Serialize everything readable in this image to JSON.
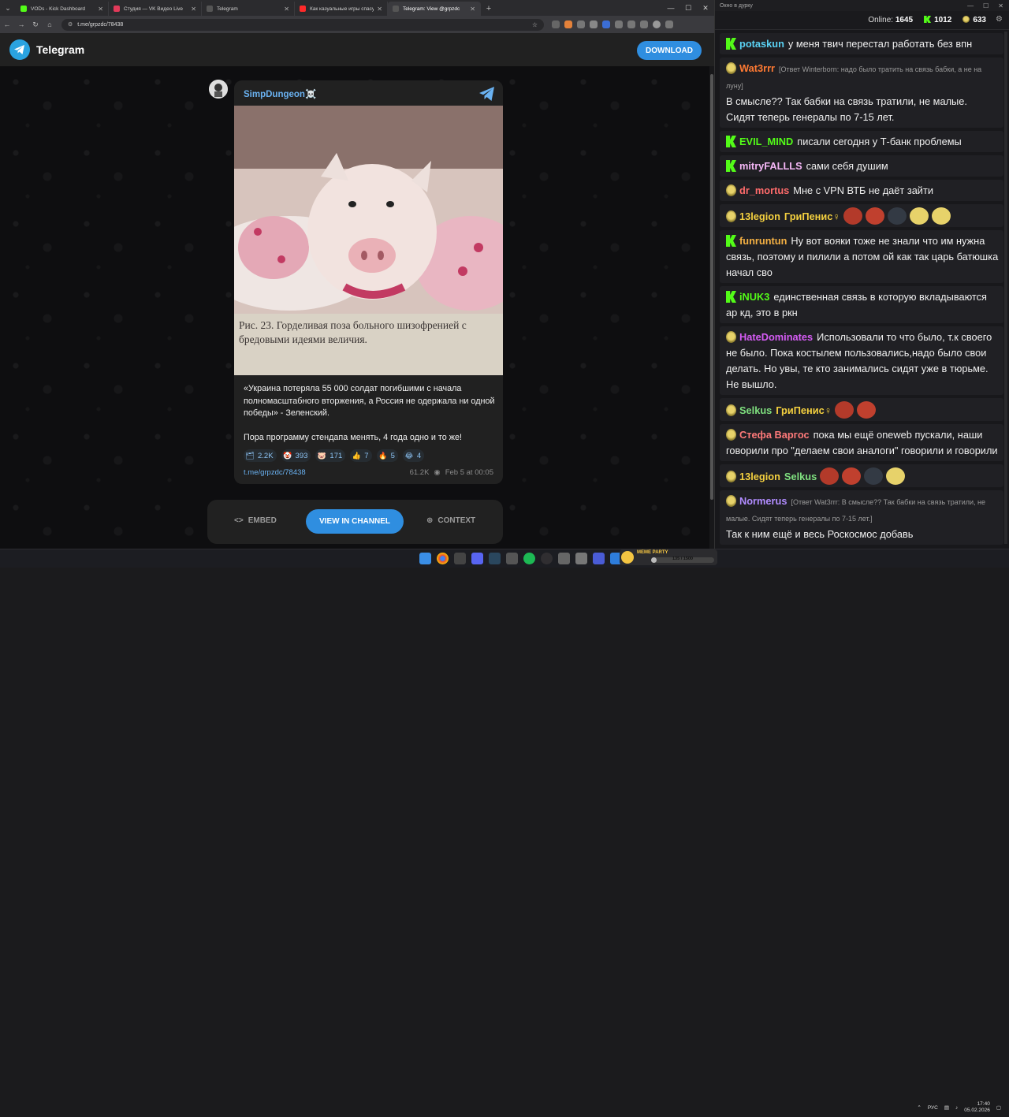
{
  "browser": {
    "tabs": [
      {
        "title": "VODs - Kick Dashboard",
        "favicon_color": "#53fc18"
      },
      {
        "title": "Студия — VK Видео Live",
        "favicon_color": "#e23a5a"
      },
      {
        "title": "Telegram",
        "favicon_color": "#555555"
      },
      {
        "title": "Как казуальные игры спасут ...",
        "favicon_color": "#ff2a2a"
      },
      {
        "title": "Telegram: View @grpzdc",
        "favicon_color": "#555555"
      }
    ],
    "url": "t.me/grpzdc/78438"
  },
  "telegram": {
    "brand": "Telegram",
    "download_label": "DOWNLOAD",
    "channel_name": "SimpDungeon☠️",
    "image_caption": "Рис. 23. Горделивая поза больного шизофренией с бредовыми идеями величия.",
    "post_text_1": "«Украина потеряла 55 000 солдат погибшими с начала полномасштабного вторжения, а Россия не одержала ни одной победы» - Зеленский.",
    "post_text_2": "Пора программу стендапа менять, 4 года одно и то же!",
    "reactions": [
      {
        "emoji": "🗂",
        "count": "2.2K"
      },
      {
        "emoji": "🤡",
        "count": "393"
      },
      {
        "emoji": "🐷",
        "count": "171"
      },
      {
        "emoji": "👍",
        "count": "7"
      },
      {
        "emoji": "🔥",
        "count": "5"
      },
      {
        "emoji": "😂",
        "count": "4"
      }
    ],
    "post_link": "t.me/grpzdc/78438",
    "views": "61.2K",
    "date": "Feb 5 at 00:05",
    "embed_label": "EMBED",
    "view_channel_label": "VIEW IN CHANNEL",
    "context_label": "CONTEXT"
  },
  "chat": {
    "window_title": "Окно в дурку",
    "online_label": "Online:",
    "online_count": "1645",
    "kick_count": "1012",
    "vk_count": "633",
    "messages": [
      {
        "badge": "k",
        "user": "potaskun",
        "color": "#5ad2f4",
        "reply": "",
        "text": "у меня твич перестал работать без впн"
      },
      {
        "badge": "peepo",
        "user": "Wat3rrr",
        "color": "#ff7a33",
        "reply": "[Ответ Winterborn: надо было тратить на связь бабки, а не на луну]",
        "text": "В смысле?? Так бабки на связь тратили, не малые. Сидят теперь генералы по 7-15 лет."
      },
      {
        "badge": "k",
        "user": "EVIL_MIND",
        "color": "#53fc18",
        "reply": "",
        "text": "писали сегодня у Т-банк проблемы"
      },
      {
        "badge": "k",
        "user": "mitryFALLLS",
        "color": "#f4b6f5",
        "reply": "",
        "text": "сами себя душим"
      },
      {
        "badge": "peepo",
        "user": "dr_mortus",
        "color": "#ff6b6b",
        "reply": "",
        "text": "Мне с VPN ВТБ не даёт зайти"
      },
      {
        "badge": "peepo",
        "user": "13legion",
        "color": "#f4d03f",
        "reply": "",
        "text": "ГриПенис♀",
        "emotes": 5
      },
      {
        "badge": "k",
        "user": "funruntun",
        "color": "#f4b043",
        "reply": "",
        "text": "Ну вот вояки тоже не знали что им нужна связь, поэтому и пилили а потом ой как так царь батюшка начал сво"
      },
      {
        "badge": "k",
        "user": "iNUK3",
        "color": "#53fc18",
        "reply": "",
        "text": "единственная связь в которую вкладываются ар кд, это в ркн"
      },
      {
        "badge": "peepo",
        "user": "HateDominates",
        "color": "#d65cf5",
        "reply": "",
        "text": "Использовали то что было, т.к своего не было. Пока костылем пользовались,надо было свои делать. Но увы, те кто занимались сидят уже в тюрьме. Не вышло."
      },
      {
        "badge": "peepo",
        "user": "Selkus",
        "color": "#7fe07f",
        "reply": "",
        "text": "ГриПенис♀",
        "emotes": 2
      },
      {
        "badge": "peepo",
        "user": "Стефа Варгос",
        "color": "#ff7a7a",
        "reply": "",
        "text": "пока мы ещё oneweb пускали, наши говорили про \"делаем свои аналоги\" говорили и говорили"
      },
      {
        "badge": "peepo",
        "user": "13legion",
        "color": "#f4d03f",
        "reply": "",
        "text": "Selkus",
        "emotes": 4
      },
      {
        "badge": "peepo",
        "user": "Normerus",
        "color": "#b18cff",
        "reply": "[Ответ Wat3rrr: В смысле?? Так бабки на связь тратили, не малые. Сидят теперь генералы по 7-15 лет.]",
        "text": "Так к ним ещё и весь Роскосмос добавь"
      }
    ]
  },
  "taskbar": {
    "widget_title": "МЕМЕ PARTY",
    "widget_progress": "135 / 1500",
    "widget_progress_fraction": 0.09,
    "lang": "РУС",
    "time": "17:40",
    "date": "05.02.2026"
  },
  "colors": {
    "telegram_blue": "#2f8ee0",
    "kick_green": "#53fc18",
    "link_blue": "#6ab2f2"
  }
}
